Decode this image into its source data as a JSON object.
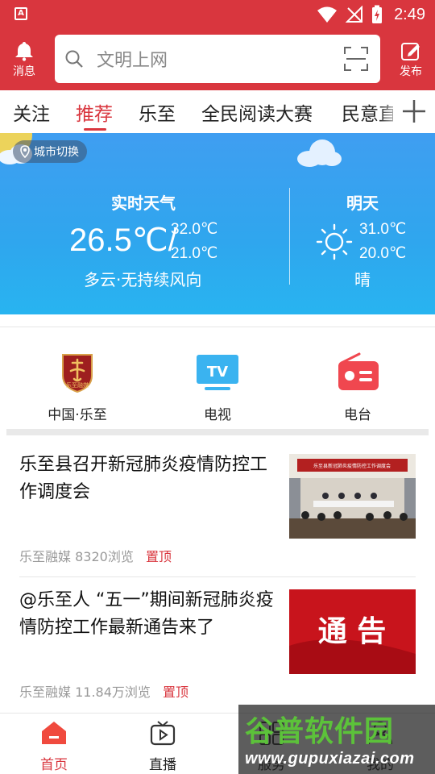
{
  "status_bar": {
    "time": "2:49",
    "app_icon_letter": "A"
  },
  "header": {
    "message_label": "消息",
    "publish_label": "发布",
    "search_placeholder": "文明上网"
  },
  "tabs": [
    {
      "label": "关注",
      "active": false
    },
    {
      "label": "推荐",
      "active": true
    },
    {
      "label": "乐至",
      "active": false
    },
    {
      "label": "全民阅读大赛",
      "active": false
    },
    {
      "label": "民意直",
      "active": false
    }
  ],
  "weather": {
    "city_switch_label": "城市切换",
    "now": {
      "title": "实时天气",
      "temp": "26.5℃/",
      "high": "32.0℃",
      "low": "21.0℃",
      "desc": "多云·无持续风向"
    },
    "tomorrow": {
      "title": "明天",
      "high": "31.0℃",
      "low": "20.0℃",
      "desc": "晴"
    }
  },
  "entries": [
    {
      "label": "中国·乐至",
      "icon": "county-emblem-icon",
      "badge_text": "乐至融媒"
    },
    {
      "label": "电视",
      "icon": "tv-icon",
      "badge_text": "TV"
    },
    {
      "label": "电台",
      "icon": "radio-icon"
    }
  ],
  "news": [
    {
      "title": "乐至县召开新冠肺炎疫情防控工作调度会",
      "source": "乐至融媒",
      "views": "8320浏览",
      "tag": "置顶",
      "thumb_caption": "乐至县新冠肺炎疫情防控工作调度会"
    },
    {
      "title": "@乐至人 “五一”期间新冠肺炎疫情防控工作最新通告来了",
      "source": "乐至融媒",
      "views": "11.84万浏览",
      "tag": "置顶",
      "thumb_text": "通  告"
    }
  ],
  "bottom_nav": [
    {
      "label": "首页",
      "active": true
    },
    {
      "label": "直播",
      "active": false
    },
    {
      "label": "服务",
      "active": false
    },
    {
      "label": "我的",
      "active": false
    }
  ],
  "watermark": {
    "name": "谷普软件园",
    "url": "www.gupuxiazai.com"
  },
  "colors": {
    "brand_red": "#d9363e",
    "sky_blue": "#3f9ef1"
  }
}
